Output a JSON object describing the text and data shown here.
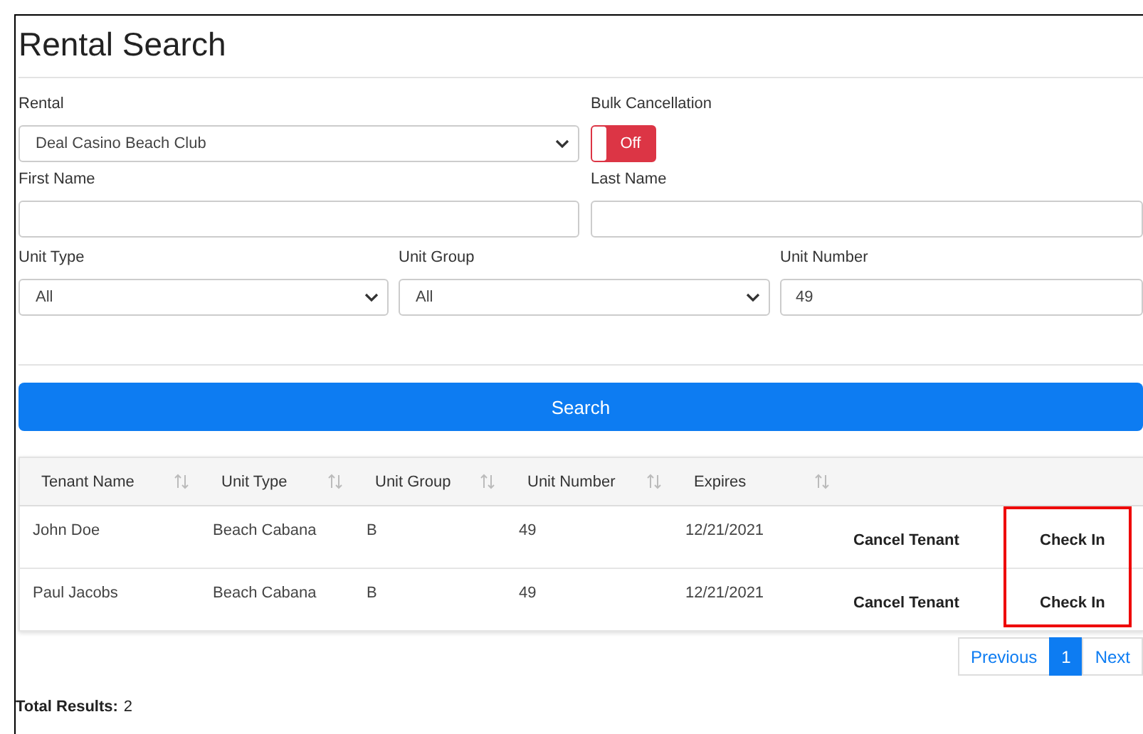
{
  "title": "Rental Search",
  "form": {
    "rental": {
      "label": "Rental",
      "value": "Deal Casino Beach Club"
    },
    "bulk_cancellation": {
      "label": "Bulk Cancellation",
      "on": false,
      "text": "Off"
    },
    "first_name": {
      "label": "First Name"
    },
    "last_name": {
      "label": "Last Name"
    },
    "unit_type": {
      "label": "Unit Type",
      "value": "All"
    },
    "unit_group": {
      "label": "Unit Group",
      "value": "All"
    },
    "unit_number": {
      "label": "Unit Number",
      "value": "49"
    }
  },
  "search_button": "Search",
  "table": {
    "columns": [
      {
        "label": "Tenant Name"
      },
      {
        "label": "Unit Type"
      },
      {
        "label": "Unit Group"
      },
      {
        "label": "Unit Number"
      },
      {
        "label": "Expires"
      }
    ],
    "rows": [
      {
        "cells": [
          "John Doe",
          "Beach Cabana",
          "B",
          "49",
          "12/21/2021"
        ],
        "actions": [
          "Cancel Tenant",
          "Check In"
        ]
      },
      {
        "cells": [
          "Paul Jacobs",
          "Beach Cabana",
          "B",
          "49",
          "12/21/2021"
        ],
        "actions": [
          "Cancel Tenant",
          "Check In"
        ]
      }
    ],
    "check_in_column_highlighted": true
  },
  "pagination": [
    {
      "label": "Previous",
      "selected": false
    },
    {
      "label": "1",
      "selected": true
    },
    {
      "label": "Next",
      "selected": false
    }
  ],
  "total": {
    "label": "Total Results:",
    "value": "2"
  }
}
